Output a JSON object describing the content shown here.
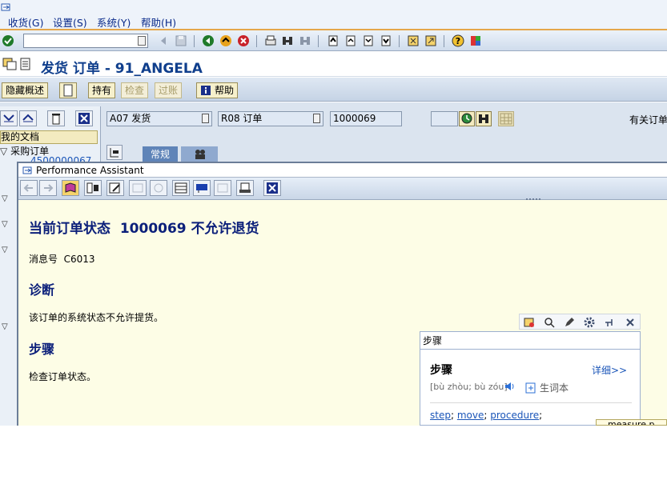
{
  "menu": {
    "items": [
      "收货(G)",
      "设置(S)",
      "系统(Y)",
      "帮助(H)"
    ]
  },
  "title": "发货 订单 - 91_ANGELA",
  "app_toolbar": {
    "hide_overview": "隐藏概述",
    "hold": "持有",
    "check": "检查",
    "post": "过账",
    "help": "帮助"
  },
  "tree": {
    "header": "我的文档",
    "purchase_order": "采购订单",
    "truncated_item": "4500000067"
  },
  "selection": {
    "transaction": "A07 发货",
    "reference": "R08 订单",
    "order_number": "1000069",
    "related_order_label": "有关订单"
  },
  "tabs": {
    "general": "常规"
  },
  "assistant": {
    "window_title": "Performance Assistant",
    "heading": "当前订单状态  1000069 不允许退货",
    "message_number": "消息号  C6013",
    "diagnosis_heading": "诊断",
    "diagnosis_text": "该订单的系统状态不允许提货。",
    "procedure_heading": "步骤",
    "procedure_text": "检查订单状态。"
  },
  "dictionary": {
    "input_value": "步骤",
    "word": "步骤",
    "details_link": "详细>>",
    "pinyin": "[bù zhòu; bù zóu]",
    "vocab_label": "生词本",
    "translations": [
      "step",
      "move",
      "procedure"
    ],
    "cut_off_tag": "measure p"
  },
  "colors": {
    "accent_orange": "#e5a64a",
    "title_blue": "#0f3e8c",
    "heading_navy": "#0b1f7a",
    "tab_blue": "#5f84b8",
    "pa_background": "#fdfde6",
    "link_blue": "#1a55b8"
  },
  "icons": {
    "menubar": "sap-system-icon",
    "standard_toolbar": [
      "enter-check-icon",
      "save-icon",
      "back-icon",
      "exit-icon",
      "cancel-icon",
      "print-icon",
      "find-icon",
      "find-next-icon",
      "first-page-icon",
      "previous-page-icon",
      "next-page-icon",
      "last-page-icon",
      "new-session-icon",
      "shortcut-icon",
      "help-icon",
      "customize-layout-icon"
    ],
    "assistant_toolbar": [
      "back-arrow-icon",
      "forward-arrow-icon",
      "book-icon",
      "technical-info-icon",
      "edit-icon",
      "disabled-icon",
      "disabled-icon",
      "table-icon",
      "info-icon",
      "disabled-icon",
      "print-icon",
      "close-icon"
    ],
    "dictionary_toolbar": [
      "pin-icon",
      "search-icon",
      "pencil-icon",
      "gear-icon",
      "pushpin-icon",
      "close-icon"
    ]
  }
}
